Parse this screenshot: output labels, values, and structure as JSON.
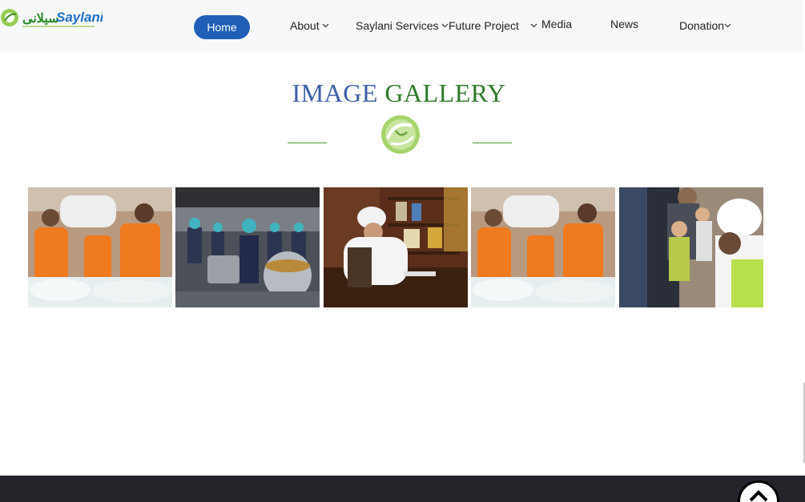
{
  "logo": {
    "name": "Saylani",
    "alt": "Saylani"
  },
  "nav": {
    "home": "Home",
    "items": [
      {
        "label": "About",
        "dropdown": true
      },
      {
        "label": "Saylani Services",
        "dropdown": true
      },
      {
        "label": "Future Project",
        "dropdown": true
      },
      {
        "label": "Media",
        "dropdown": false
      },
      {
        "label": "News",
        "dropdown": false
      },
      {
        "label": "Donation",
        "dropdown": true
      }
    ]
  },
  "gallery": {
    "title_part1": "IMAGE",
    "title_part2": "GALLERY",
    "images": [
      {
        "subject": "Volunteers in orange shirts carrying sacks"
      },
      {
        "subject": "Kitchen staff cooking in large pots"
      },
      {
        "subject": "Elder in white turban seated at desk"
      },
      {
        "subject": "Volunteers in orange shirts carrying sacks"
      },
      {
        "subject": "Man in white turban with children"
      }
    ]
  },
  "colors": {
    "brand_blue": "#1f5fb8",
    "brand_green": "#2f7a2a",
    "title_blue": "#3c5fa8",
    "footer": "#23242a"
  },
  "icons": [
    "chevron-down-icon",
    "chevron-up-icon",
    "saylani-emblem-icon"
  ]
}
